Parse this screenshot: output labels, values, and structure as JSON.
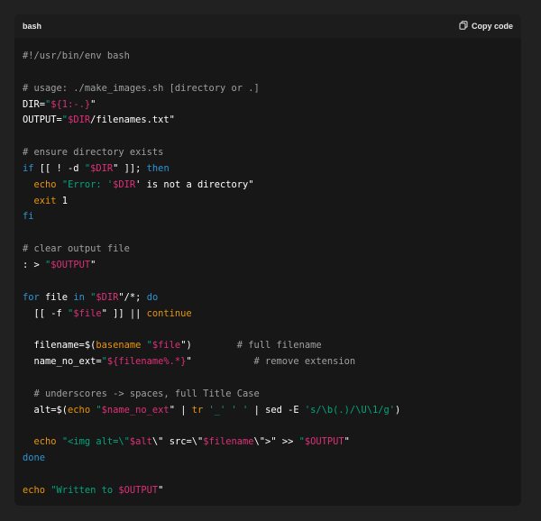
{
  "header": {
    "language": "bash",
    "copy_label": "Copy code",
    "copy_icon": "copy-icon"
  },
  "colors": {
    "comment": "#a0a0a0",
    "keyword": "#2e95d3",
    "string": "#00a67d",
    "variable": "#df3079",
    "builtin": "#e9950c",
    "plain": "#ffffff"
  },
  "code": {
    "lines": [
      [
        [
          "c",
          "#!/usr/bin/env bash"
        ]
      ],
      [],
      [
        [
          "c",
          "# usage: ./make_images.sh [directory or .]"
        ]
      ],
      [
        [
          "p",
          "DIR="
        ],
        [
          "s",
          "\""
        ],
        [
          "v",
          "${1:-.}"
        ],
        [
          "p",
          "\""
        ]
      ],
      [
        [
          "p",
          "OUTPUT="
        ],
        [
          "s",
          "\""
        ],
        [
          "v",
          "$DIR"
        ],
        [
          "p",
          "/filenames.txt\""
        ]
      ],
      [],
      [
        [
          "c",
          "# ensure directory exists"
        ]
      ],
      [
        [
          "k",
          "if"
        ],
        [
          "p",
          " [[ ! -d "
        ],
        [
          "s",
          "\""
        ],
        [
          "v",
          "$DIR"
        ],
        [
          "p",
          "\" ]]; "
        ],
        [
          "k",
          "then"
        ]
      ],
      [
        [
          "p",
          "  "
        ],
        [
          "b",
          "echo"
        ],
        [
          "p",
          " "
        ],
        [
          "s",
          "\"Error: '"
        ],
        [
          "v",
          "$DIR"
        ],
        [
          "p",
          "' is not a directory\""
        ]
      ],
      [
        [
          "p",
          "  "
        ],
        [
          "b",
          "exit"
        ],
        [
          "p",
          " 1"
        ]
      ],
      [
        [
          "k",
          "fi"
        ]
      ],
      [],
      [
        [
          "c",
          "# clear output file"
        ]
      ],
      [
        [
          "p",
          ": > "
        ],
        [
          "s",
          "\""
        ],
        [
          "v",
          "$OUTPUT"
        ],
        [
          "p",
          "\""
        ]
      ],
      [],
      [
        [
          "k",
          "for"
        ],
        [
          "p",
          " file "
        ],
        [
          "k",
          "in"
        ],
        [
          "p",
          " "
        ],
        [
          "s",
          "\""
        ],
        [
          "v",
          "$DIR"
        ],
        [
          "p",
          "\"/*; "
        ],
        [
          "k",
          "do"
        ]
      ],
      [
        [
          "p",
          "  [[ -f "
        ],
        [
          "s",
          "\""
        ],
        [
          "v",
          "$file"
        ],
        [
          "p",
          "\" ]] || "
        ],
        [
          "b",
          "continue"
        ]
      ],
      [],
      [
        [
          "p",
          "  filename=$("
        ],
        [
          "b",
          "basename"
        ],
        [
          "p",
          " "
        ],
        [
          "s",
          "\""
        ],
        [
          "v",
          "$file"
        ],
        [
          "p",
          "\")        "
        ],
        [
          "c",
          "# full filename"
        ]
      ],
      [
        [
          "p",
          "  name_no_ext="
        ],
        [
          "s",
          "\""
        ],
        [
          "v",
          "${filename%.*}"
        ],
        [
          "p",
          "\"           "
        ],
        [
          "c",
          "# remove extension"
        ]
      ],
      [],
      [
        [
          "c",
          "  # underscores -> spaces, full Title Case"
        ]
      ],
      [
        [
          "p",
          "  alt=$("
        ],
        [
          "b",
          "echo"
        ],
        [
          "p",
          " "
        ],
        [
          "s",
          "\""
        ],
        [
          "v",
          "$name_no_ext"
        ],
        [
          "p",
          "\" | "
        ],
        [
          "b",
          "tr"
        ],
        [
          "p",
          " "
        ],
        [
          "s",
          "'_'"
        ],
        [
          "p",
          " "
        ],
        [
          "s",
          "' '"
        ],
        [
          "p",
          " | sed -E "
        ],
        [
          "s",
          "'s/\\b(.)/\\U\\1/g'"
        ],
        [
          "p",
          ")"
        ]
      ],
      [],
      [
        [
          "p",
          "  "
        ],
        [
          "b",
          "echo"
        ],
        [
          "p",
          " "
        ],
        [
          "s",
          "\"<img alt=\\\""
        ],
        [
          "v",
          "$alt"
        ],
        [
          "p",
          "\\\" src=\\\""
        ],
        [
          "v",
          "$filename"
        ],
        [
          "p",
          "\\\">\" >> "
        ],
        [
          "s",
          "\""
        ],
        [
          "v",
          "$OUTPUT"
        ],
        [
          "p",
          "\""
        ]
      ],
      [
        [
          "k",
          "done"
        ]
      ],
      [],
      [
        [
          "b",
          "echo"
        ],
        [
          "p",
          " "
        ],
        [
          "s",
          "\"Written to "
        ],
        [
          "v",
          "$OUTPUT"
        ],
        [
          "p",
          "\""
        ]
      ]
    ]
  }
}
